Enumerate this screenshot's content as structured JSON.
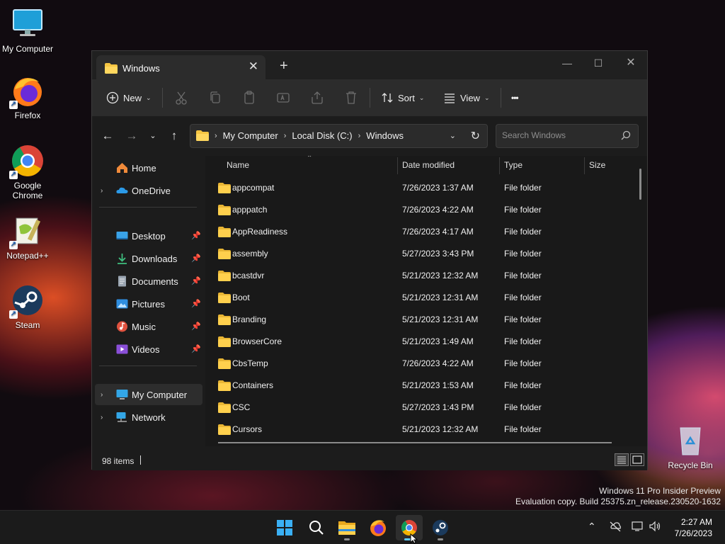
{
  "desktop": {
    "icons": [
      {
        "label": "My Computer"
      },
      {
        "label": "Firefox"
      },
      {
        "label": "Google Chrome"
      },
      {
        "label": "Notepad++"
      },
      {
        "label": "Steam"
      },
      {
        "label": "Recycle Bin"
      }
    ],
    "watermark": {
      "line1": "Windows 11 Pro Insider Preview",
      "line2": "Evaluation copy. Build 25375.zn_release.230520-1632"
    }
  },
  "explorer": {
    "tab_title": "Windows",
    "toolbar": {
      "new_label": "New",
      "sort_label": "Sort",
      "view_label": "View",
      "more_label": "•••"
    },
    "address": {
      "crumbs": [
        "My Computer",
        "Local Disk (C:)",
        "Windows"
      ]
    },
    "search": {
      "placeholder": "Search Windows"
    },
    "sidebar": {
      "items": [
        {
          "label": "Home"
        },
        {
          "label": "OneDrive"
        },
        {
          "label": "Desktop"
        },
        {
          "label": "Downloads"
        },
        {
          "label": "Documents"
        },
        {
          "label": "Pictures"
        },
        {
          "label": "Music"
        },
        {
          "label": "Videos"
        },
        {
          "label": "My Computer"
        },
        {
          "label": "Network"
        }
      ]
    },
    "columns": {
      "name": "Name",
      "date": "Date modified",
      "type": "Type",
      "size": "Size"
    },
    "files": [
      {
        "name": "appcompat",
        "date": "7/26/2023 1:37 AM",
        "type": "File folder"
      },
      {
        "name": "apppatch",
        "date": "7/26/2023 4:22 AM",
        "type": "File folder"
      },
      {
        "name": "AppReadiness",
        "date": "7/26/2023 4:17 AM",
        "type": "File folder"
      },
      {
        "name": "assembly",
        "date": "5/27/2023 3:43 PM",
        "type": "File folder"
      },
      {
        "name": "bcastdvr",
        "date": "5/21/2023 12:32 AM",
        "type": "File folder"
      },
      {
        "name": "Boot",
        "date": "5/21/2023 12:31 AM",
        "type": "File folder"
      },
      {
        "name": "Branding",
        "date": "5/21/2023 12:31 AM",
        "type": "File folder"
      },
      {
        "name": "BrowserCore",
        "date": "5/21/2023 1:49 AM",
        "type": "File folder"
      },
      {
        "name": "CbsTemp",
        "date": "7/26/2023 4:22 AM",
        "type": "File folder"
      },
      {
        "name": "Containers",
        "date": "5/21/2023 1:53 AM",
        "type": "File folder"
      },
      {
        "name": "CSC",
        "date": "5/27/2023 1:43 PM",
        "type": "File folder"
      },
      {
        "name": "Cursors",
        "date": "5/21/2023 12:32 AM",
        "type": "File folder"
      }
    ],
    "status": {
      "item_count": "98 items"
    }
  },
  "taskbar": {
    "clock": {
      "time": "2:27 AM",
      "date": "7/26/2023"
    }
  }
}
